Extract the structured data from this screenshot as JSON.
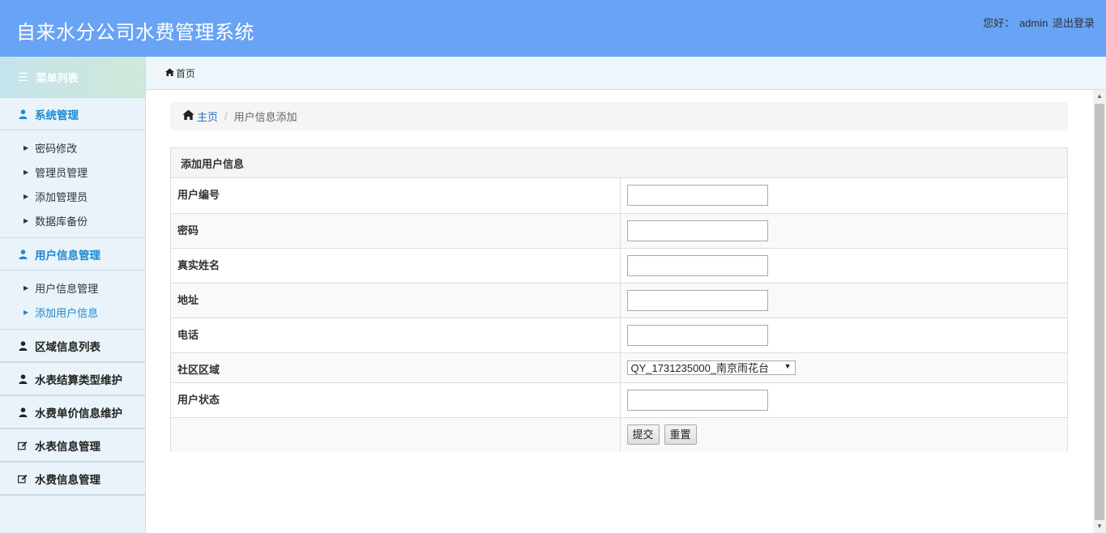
{
  "header": {
    "title": "自来水分公司水费管理系统",
    "greeting": "您好：",
    "username": "admin",
    "logout": "退出登录"
  },
  "sidebar": {
    "menu_title": "菜单列表",
    "groups": [
      {
        "label": "系统管理",
        "items": [
          "密码修改",
          "管理员管理",
          "添加管理员",
          "数据库备份"
        ]
      },
      {
        "label": "用户信息管理",
        "items": [
          "用户信息管理",
          "添加用户信息"
        ]
      },
      {
        "label": "区域信息列表"
      },
      {
        "label": "水表结算类型维护"
      },
      {
        "label": "水费单价信息维护"
      },
      {
        "label": "水表信息管理"
      },
      {
        "label": "水费信息管理"
      }
    ]
  },
  "topbar": {
    "home": "首页"
  },
  "breadcrumb": {
    "home": "主页",
    "separator": "/",
    "current": "用户信息添加"
  },
  "form": {
    "title": "添加用户信息",
    "fields": [
      {
        "label": "用户编号",
        "value": ""
      },
      {
        "label": "密码",
        "value": ""
      },
      {
        "label": "真实姓名",
        "value": ""
      },
      {
        "label": "地址",
        "value": ""
      },
      {
        "label": "电话",
        "value": ""
      },
      {
        "label": "社区区域",
        "selected": "QY_1731235000_南京雨花台"
      },
      {
        "label": "用户状态",
        "value": ""
      }
    ],
    "submit": "提交",
    "reset": "重置"
  },
  "colors": {
    "header_bg": "#68a3f5",
    "active_link": "#1a8ad2",
    "sidebar_bg": "#e9f3f9"
  }
}
